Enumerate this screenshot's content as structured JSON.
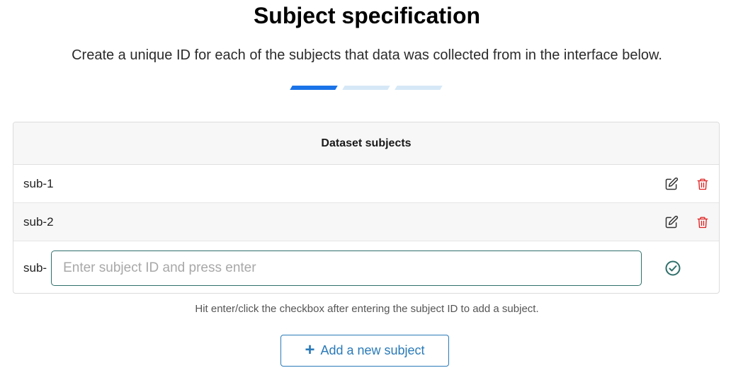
{
  "page": {
    "title": "Subject specification",
    "subtitle": "Create a unique ID for each of the subjects that data was collected from in the interface below."
  },
  "stepper": {
    "total_steps": 3,
    "active_step": 1
  },
  "table": {
    "header": "Dataset subjects",
    "rows": [
      {
        "label": "sub-1"
      },
      {
        "label": "sub-2"
      }
    ],
    "new_row": {
      "prefix": "sub-",
      "input_value": "",
      "input_placeholder": "Enter subject ID and press enter"
    }
  },
  "hint": "Hit enter/click the checkbox after entering the subject ID to add a subject.",
  "add_button": {
    "icon": "plus-icon",
    "label": "Add a new subject"
  },
  "colors": {
    "accent_blue": "#1a73e8",
    "step_inactive": "#d6e8f7",
    "delete_red": "#e02020",
    "confirm_green": "#2f6f6a",
    "button_blue": "#2a7ab8"
  },
  "icons": {
    "edit": "edit-icon",
    "delete": "trash-icon",
    "confirm": "check-circle-icon"
  }
}
